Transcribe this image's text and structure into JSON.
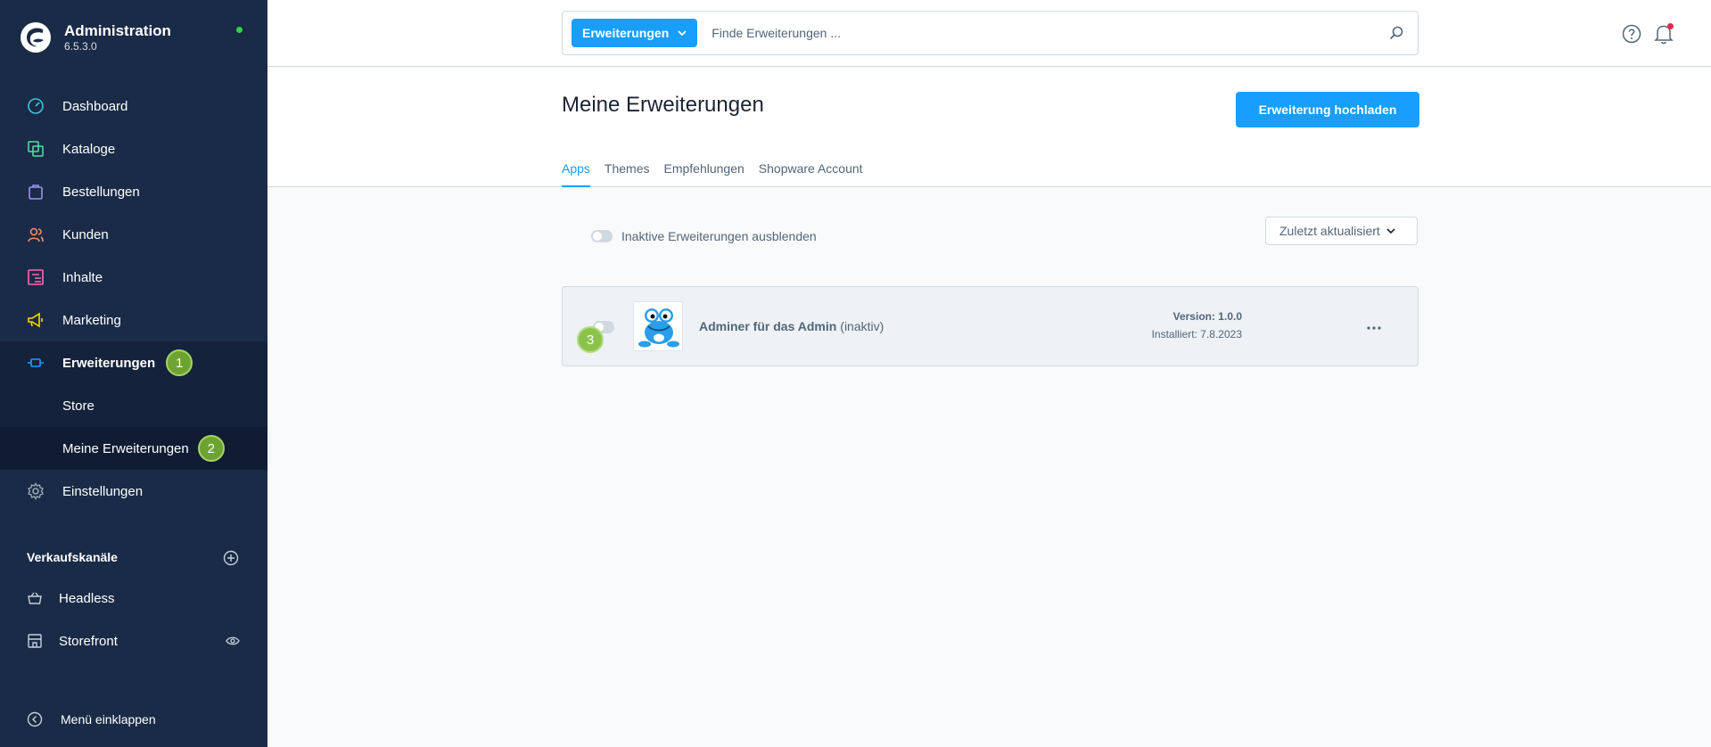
{
  "app": {
    "title": "Administration",
    "version": "6.5.3.0"
  },
  "colors": {
    "sidebar_bg": "#1a2b47",
    "accent": "#189eff",
    "status_online": "#37d046",
    "badge_green": "#6da431"
  },
  "sidebar": {
    "items": [
      {
        "label": "Dashboard",
        "icon": "dashboard-icon"
      },
      {
        "label": "Kataloge",
        "icon": "catalog-icon"
      },
      {
        "label": "Bestellungen",
        "icon": "orders-icon"
      },
      {
        "label": "Kunden",
        "icon": "customers-icon"
      },
      {
        "label": "Inhalte",
        "icon": "content-icon"
      },
      {
        "label": "Marketing",
        "icon": "marketing-icon"
      },
      {
        "label": "Erweiterungen",
        "icon": "extensions-icon",
        "badge": "1"
      },
      {
        "label": "Einstellungen",
        "icon": "settings-icon"
      }
    ],
    "subitems": [
      {
        "label": "Store"
      },
      {
        "label": "Meine Erweiterungen",
        "badge": "2"
      }
    ],
    "sales_channels_title": "Verkaufskanäle",
    "sales_channels": [
      {
        "label": "Headless",
        "icon": "basket-icon"
      },
      {
        "label": "Storefront",
        "icon": "storefront-icon"
      }
    ],
    "collapse_label": "Menü einklappen"
  },
  "search": {
    "type_label": "Erweiterungen",
    "placeholder": "Finde Erweiterungen ..."
  },
  "page": {
    "title": "Meine Erweiterungen",
    "upload_label": "Erweiterung hochladen",
    "tabs": [
      "Apps",
      "Themes",
      "Empfehlungen",
      "Shopware Account"
    ]
  },
  "filter": {
    "hide_inactive_label": "Inaktive Erweiterungen ausblenden",
    "sort_label": "Zuletzt aktualisiert"
  },
  "extension": {
    "name": "Adminer für das Admin",
    "state": "(inaktiv)",
    "version": "Version: 1.0.0",
    "installed": "Installiert: 7.8.2023",
    "badge": "3"
  }
}
